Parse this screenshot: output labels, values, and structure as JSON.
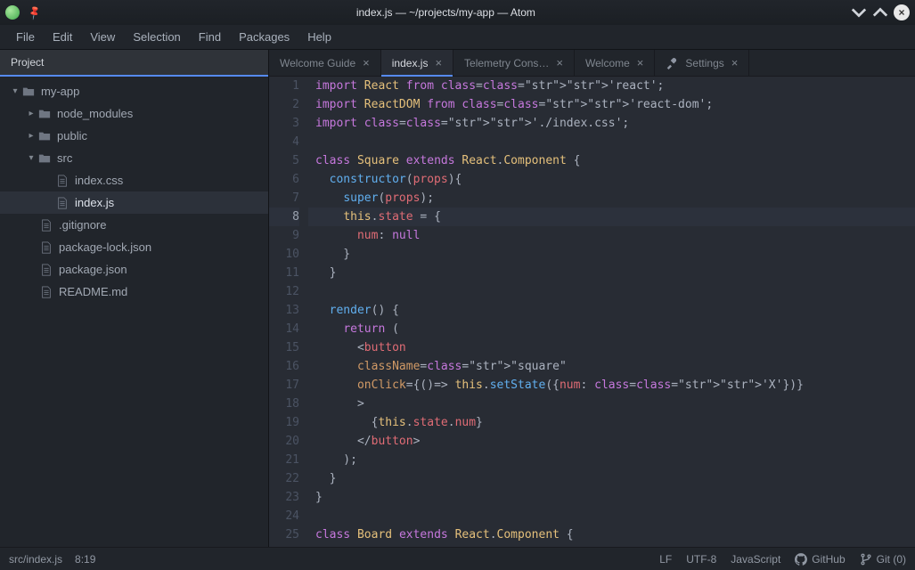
{
  "window": {
    "title": "index.js — ~/projects/my-app — Atom"
  },
  "menu": [
    "File",
    "Edit",
    "View",
    "Selection",
    "Find",
    "Packages",
    "Help"
  ],
  "project_panel_title": "Project",
  "tree": {
    "root": {
      "name": "my-app"
    },
    "items": [
      {
        "name": "node_modules",
        "type": "folder",
        "expanded": false,
        "indent": 28
      },
      {
        "name": "public",
        "type": "folder",
        "expanded": false,
        "indent": 28
      },
      {
        "name": "src",
        "type": "folder",
        "expanded": true,
        "indent": 28
      },
      {
        "name": "index.css",
        "type": "file",
        "indent": 62
      },
      {
        "name": "index.js",
        "type": "file",
        "indent": 62,
        "selected": true
      },
      {
        "name": ".gitignore",
        "type": "file",
        "indent": 44
      },
      {
        "name": "package-lock.json",
        "type": "file",
        "indent": 44
      },
      {
        "name": "package.json",
        "type": "file",
        "indent": 44
      },
      {
        "name": "README.md",
        "type": "file",
        "indent": 44
      }
    ]
  },
  "tabs": [
    {
      "label": "Welcome Guide",
      "icon": null,
      "closable": true
    },
    {
      "label": "index.js",
      "icon": null,
      "closable": true,
      "active": true
    },
    {
      "label": "Telemetry Cons…",
      "icon": null,
      "closable": true
    },
    {
      "label": "Welcome",
      "icon": null,
      "closable": true
    },
    {
      "label": "Settings",
      "icon": "tools",
      "closable": true
    }
  ],
  "editor": {
    "current_line": 8,
    "lines": [
      "import React from 'react';",
      "import ReactDOM from 'react-dom';",
      "import './index.css';",
      "",
      "class Square extends React.Component {",
      "  constructor(props){",
      "    super(props);",
      "    this.state = {",
      "      num: null",
      "    }",
      "  }",
      "",
      "  render() {",
      "    return (",
      "      <button",
      "      className=\"square\"",
      "      onClick={()=> this.setState({num: 'X'})}",
      "      >",
      "        {this.state.num}",
      "      </button>",
      "    );",
      "  }",
      "}",
      "",
      "class Board extends React.Component {"
    ]
  },
  "status": {
    "file": "src/index.js",
    "cursor": "8:19",
    "eol": "LF",
    "encoding": "UTF-8",
    "grammar": "JavaScript",
    "github": "GitHub",
    "git": "Git (0)"
  }
}
